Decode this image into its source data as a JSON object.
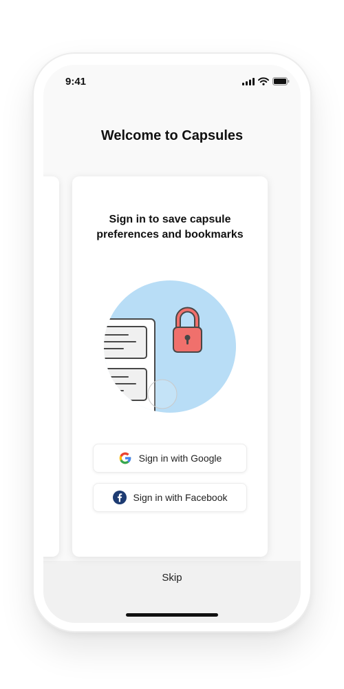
{
  "status_bar": {
    "time": "9:41",
    "icons": [
      "signal-icon",
      "wifi-icon",
      "battery-icon"
    ]
  },
  "header": {
    "title": "Welcome to Capsules"
  },
  "card": {
    "heading": "Sign in to save capsule preferences and bookmarks",
    "illustration_icons": [
      "lock-icon",
      "document-icon"
    ]
  },
  "buttons": {
    "google": {
      "label": "Sign in with Google",
      "icon": "google-icon"
    },
    "facebook": {
      "label": "Sign in with Facebook",
      "icon": "facebook-icon"
    }
  },
  "skip_label": "Skip",
  "colors": {
    "illustration_bg": "#b8ddf6",
    "lock": "#f0706c",
    "facebook": "#1d3b72",
    "google_blue": "#4285f4",
    "google_red": "#ea4335",
    "google_yellow": "#fbbc05",
    "google_green": "#34a853"
  }
}
